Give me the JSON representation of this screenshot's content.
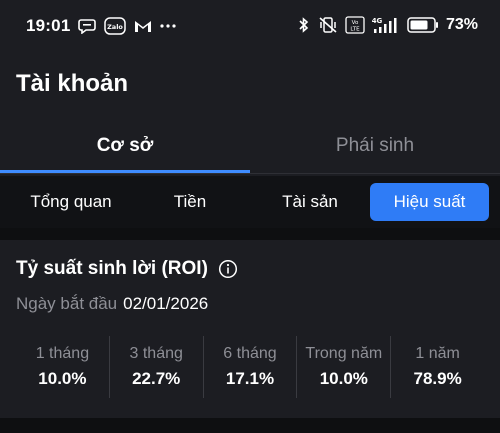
{
  "status_bar": {
    "time": "19:01",
    "battery_percent": "73%",
    "left_icons": [
      "chat-bubble-icon",
      "zalo-icon",
      "gmail-icon",
      "more-dots-icon"
    ],
    "right_icons": [
      "bluetooth-icon",
      "mute-vibrate-icon",
      "volte-icon",
      "4g-signal-icon",
      "battery-icon"
    ],
    "zalo_text": "Zalo",
    "volte_text": "Vo LTE",
    "network_text": "4G"
  },
  "header": {
    "title": "Tài khoản"
  },
  "tabs": [
    {
      "label": "Cơ sở",
      "active": true
    },
    {
      "label": "Phái sinh",
      "active": false
    }
  ],
  "subtabs": [
    {
      "label": "Tổng quan",
      "active": false
    },
    {
      "label": "Tiền",
      "active": false
    },
    {
      "label": "Tài sản",
      "active": false
    },
    {
      "label": "Hiệu suất",
      "active": true
    }
  ],
  "roi": {
    "title": "Tỷ suất sinh lời (ROI)",
    "start_label": "Ngày bắt đầu",
    "start_date": "02/01/2026",
    "periods": [
      {
        "label": "1 tháng",
        "value": "10.0%"
      },
      {
        "label": "3 tháng",
        "value": "22.7%"
      },
      {
        "label": "6 tháng",
        "value": "17.1%"
      },
      {
        "label": "Trong năm",
        "value": "10.0%"
      },
      {
        "label": "1 năm",
        "value": "78.9%"
      }
    ]
  },
  "colors": {
    "accent": "#2f7cf6",
    "background": "#1c1d22",
    "muted_text": "#8e8f96"
  }
}
